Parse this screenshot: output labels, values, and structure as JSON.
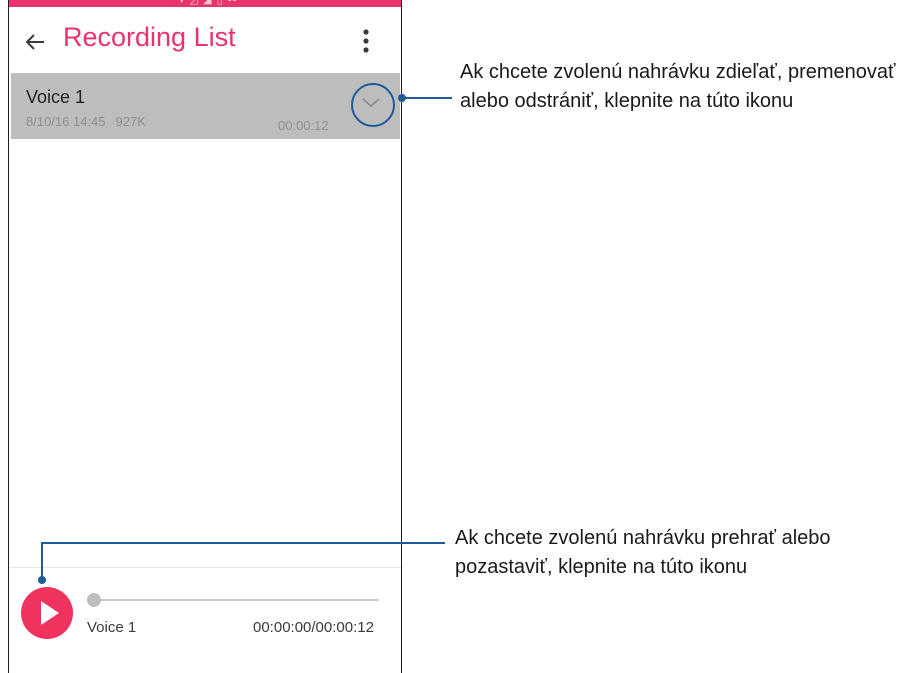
{
  "status_bar": {
    "glyphs": "▾ ◿ ◢ ▯ ▪▪"
  },
  "app_bar": {
    "title": "Recording List",
    "back_icon": "arrow-left-icon",
    "overflow_icon": "more-vertical-icon"
  },
  "recording": {
    "name": "Voice 1",
    "date": "8/10/16 14:45",
    "size": "927K",
    "duration": "00:00:12",
    "dropdown_icon": "chevron-down-icon"
  },
  "player": {
    "track_name": "Voice 1",
    "time": "00:00:00/00:00:12",
    "progress_fraction": 0,
    "play_icon": "play-icon"
  },
  "callouts": {
    "options_hint": "Ak chcete zvolenú nahrávku zdieľať, premenovať alebo odstrániť, klepnite na túto ikonu",
    "play_hint": "Ak chcete zvolenú nahrávku prehrať alebo pozastaviť, klepnite na túto ikonu"
  },
  "colors": {
    "accent": "#e8336b",
    "play_button": "#f0325f",
    "selected_row": "#bdbdbd",
    "callout_line": "#1f5b99"
  }
}
